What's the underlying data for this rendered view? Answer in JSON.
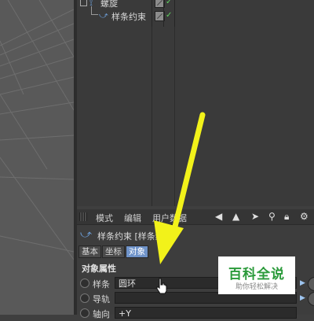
{
  "object_manager": {
    "items": [
      {
        "label": "螺旋"
      },
      {
        "label": "样条约束"
      }
    ]
  },
  "attribute_manager": {
    "menu": [
      "模式",
      "编辑",
      "用户数据"
    ],
    "header_title": "样条约束 [样条约束]",
    "tabs": [
      {
        "label": "基本",
        "active": false
      },
      {
        "label": "坐标",
        "active": false
      },
      {
        "label": "对象",
        "active": true
      }
    ],
    "section_title": "对象属性",
    "properties": [
      {
        "label": "样条",
        "value": "圆环"
      },
      {
        "label": "导轨",
        "value": ""
      },
      {
        "label": "轴向",
        "value": "+Y"
      }
    ]
  },
  "watermark": {
    "title": "百科全说",
    "subtitle": "助你轻松解决"
  },
  "colors": {
    "arrow": "#f2f21a",
    "active_tab": "#6f93c9",
    "watermark_green": "#2a9a3a"
  }
}
